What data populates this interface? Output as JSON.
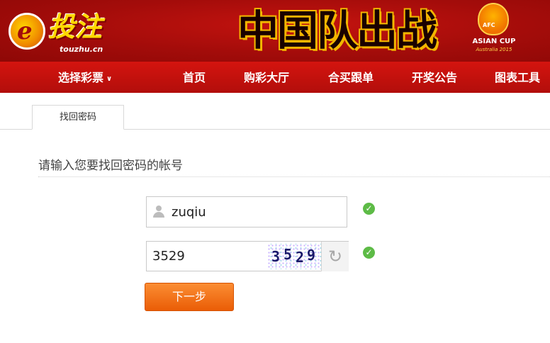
{
  "header": {
    "logo_text": "投注",
    "logo_site": "touzhu.cn",
    "banner_title": "中国队出战",
    "afc": {
      "badge": "AFC",
      "title": "ASIAN CUP",
      "subtitle": "Australia 2015"
    }
  },
  "nav": {
    "items": [
      {
        "label": "选择彩票",
        "icon": "chevron-down-icon"
      },
      {
        "label": "首页"
      },
      {
        "label": "购彩大厅"
      },
      {
        "label": "合买跟单"
      },
      {
        "label": "开奖公告"
      },
      {
        "label": "图表工具"
      }
    ]
  },
  "tabs": [
    {
      "label": "找回密码",
      "active": true
    }
  ],
  "form": {
    "prompt": "请输入您要找回密码的帐号",
    "username": {
      "value": "zuqiu",
      "icon": "user-icon",
      "status": "valid"
    },
    "captcha": {
      "value": "3529",
      "image_text": "3529",
      "refresh_icon": "refresh-icon",
      "status": "valid"
    },
    "submit_label": "下一步"
  },
  "colors": {
    "header_red": "#a30c0a",
    "nav_red": "#c8110d",
    "button_orange": "#f47a1f",
    "check_green": "#5dbb46"
  }
}
